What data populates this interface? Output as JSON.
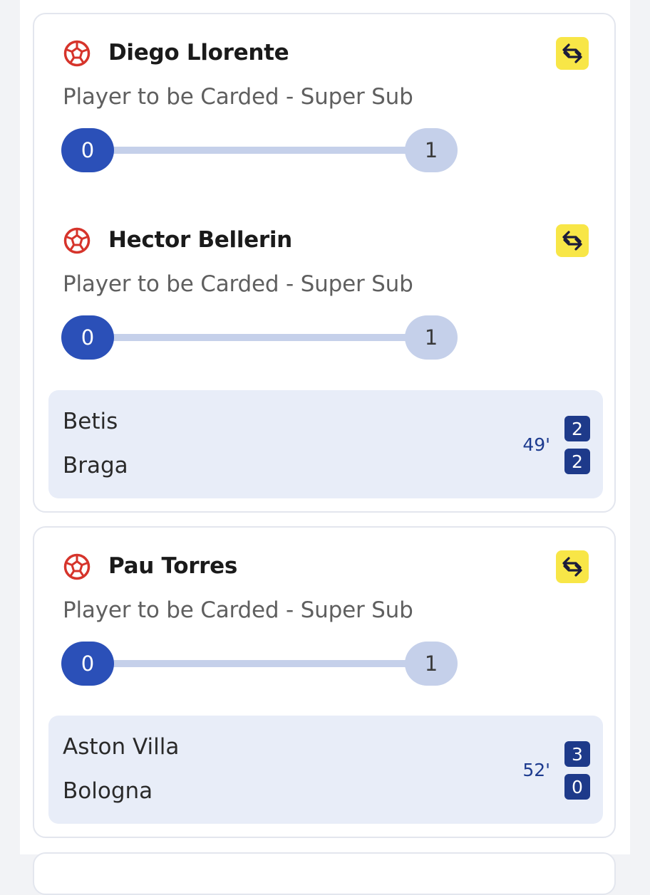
{
  "cards": [
    {
      "legs": [
        {
          "player": "Diego Llorente",
          "market": "Player to be Carded - Super Sub",
          "progress_start": "0",
          "progress_end": "1",
          "progress_value": 0
        },
        {
          "player": "Hector Bellerin",
          "market": "Player to be Carded - Super Sub",
          "progress_start": "0",
          "progress_end": "1",
          "progress_value": 0
        }
      ],
      "match": {
        "home_team": "Betis",
        "away_team": "Braga",
        "minute": "49'",
        "home_score": "2",
        "away_score": "2"
      }
    },
    {
      "legs": [
        {
          "player": "Pau Torres",
          "market": "Player to be Carded - Super Sub",
          "progress_start": "0",
          "progress_end": "1",
          "progress_value": 0
        }
      ],
      "match": {
        "home_team": "Aston Villa",
        "away_team": "Bologna",
        "minute": "52'",
        "home_score": "3",
        "away_score": "0"
      }
    }
  ],
  "icons": {
    "sport": "football-icon",
    "swap": "swap-arrows-icon"
  },
  "colors": {
    "accent_blue": "#2b50b8",
    "track_light": "#c5d0ea",
    "score_badge": "#1e3a8a",
    "swap_yellow": "#f8e647",
    "football_red": "#d6342b",
    "match_bg": "#e8edf8"
  }
}
